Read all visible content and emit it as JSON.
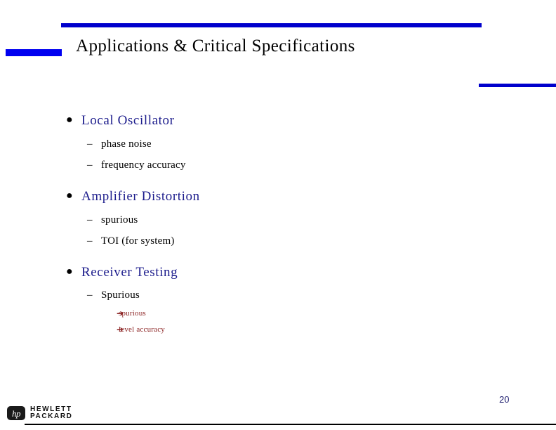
{
  "slide": {
    "title": "Applications & Critical Specifications",
    "page_number": "20",
    "accent_color": "#0000cc",
    "level1_color": "#1c1c8c",
    "level2_color": "#000000",
    "level3_color": "#8b2222",
    "bullet_marker": "●",
    "dash_marker": "–",
    "arrow_marker": "➔"
  },
  "content": {
    "groups": [
      {
        "label": "Local Oscillator",
        "subitems": [
          {
            "label": "phase noise",
            "subitems": []
          },
          {
            "label": "frequency accuracy",
            "subitems": []
          }
        ]
      },
      {
        "label": "Amplifier Distortion",
        "subitems": [
          {
            "label": "spurious",
            "subitems": []
          },
          {
            "label": "TOI (for system)",
            "subitems": []
          }
        ]
      },
      {
        "label": "Receiver Testing",
        "subitems": [
          {
            "label": "Spurious",
            "subitems": [
              {
                "label": "spurious"
              },
              {
                "label": "level accuracy"
              }
            ]
          }
        ]
      }
    ]
  },
  "logo": {
    "mark": "hp",
    "line1": "HEWLETT",
    "line2": "PACKARD"
  }
}
